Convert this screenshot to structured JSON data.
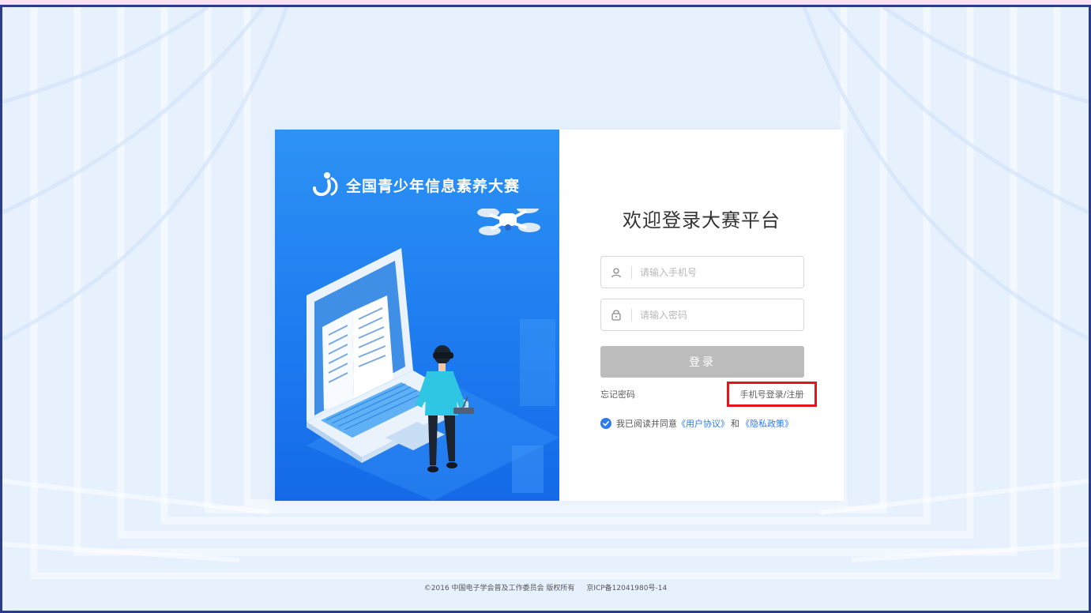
{
  "brand": {
    "title": "全国青少年信息素养大赛",
    "logo_icon": "contest-logo-icon"
  },
  "login": {
    "heading": "欢迎登录大赛平台",
    "phone_placeholder": "请输入手机号",
    "password_placeholder": "请输入密码",
    "submit_label": "登录",
    "forgot_label": "忘记密码",
    "phone_login_label": "手机号登录/注册",
    "agree_prefix": "我已阅读并同意",
    "agreement_link": "《用户协议》",
    "and_text": "和",
    "privacy_link": "《隐私政策》",
    "agree_checked": true
  },
  "footer": {
    "copyright": "©2016 中国电子学会普及工作委员会 版权所有",
    "icp": "京ICP备12041980号-14"
  },
  "colors": {
    "accent": "#2d7bf0",
    "panel_blue": "#1f7ef0",
    "button_disabled": "#bcbcbc",
    "highlight_box": "#e0161b"
  }
}
